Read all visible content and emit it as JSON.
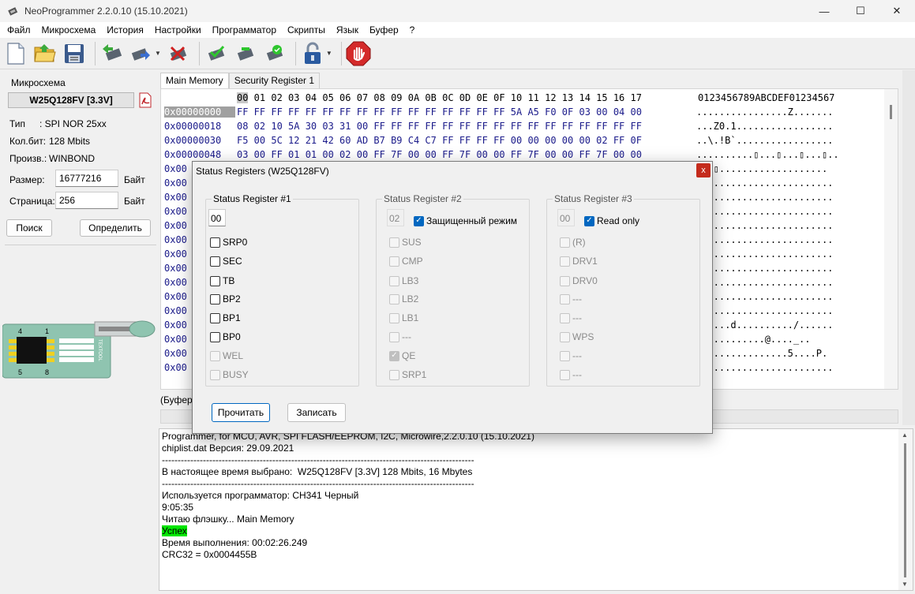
{
  "window": {
    "title": "NeoProgrammer 2.2.0.10 (15.10.2021)"
  },
  "menu": [
    "Файл",
    "Микросхема",
    "История",
    "Настройки",
    "Программатор",
    "Скрипты",
    "Язык",
    "Буфер",
    "?"
  ],
  "left": {
    "group_title": "Микросхема",
    "chip_name": "W25Q128FV [3.3V]",
    "type_label": "Тип",
    "type_value": ":  SPI NOR  25xx",
    "bits_label": "Кол.бит:",
    "bits_value": "128 Mbits",
    "mfr_label": "Произв.:",
    "mfr_value": "WINBOND",
    "size_label": "Размер:",
    "size_value": "16777216",
    "size_unit": "Байт",
    "page_label": "Страница:",
    "page_value": "256",
    "page_unit": "Байт",
    "search_btn": "Поиск",
    "detect_btn": "Определить"
  },
  "chip_image": {
    "pin4": "4",
    "pin1": "1",
    "pin5": "5",
    "pin8": "8",
    "brand": "TEXTOOL"
  },
  "tabs": [
    "Main Memory",
    "Security Register 1"
  ],
  "hex": {
    "header_first": "00",
    "header_rest": " 01 02 03 04 05 06 07 08 09 0A 0B 0C 0D 0E 0F 10 11 12 13 14 15 16 17",
    "ascii_header": "0123456789ABCDEF01234567",
    "rows": [
      {
        "addr": "0x00000000",
        "bytes": "FF FF FF FF FF FF FF FF FF FF FF FF FF FF FF FF 5A A5 F0 0F 03 00 04 00",
        "ascii": "................Z......."
      },
      {
        "addr": "0x00000018",
        "bytes": "08 02 10 5A 30 03 31 00 FF FF FF FF FF FF FF FF FF FF FF FF FF FF FF FF",
        "ascii": "...Z0.1................."
      },
      {
        "addr": "0x00000030",
        "bytes": "F5 00 5C 12 21 42 60 AD B7 B9 C4 C7 FF FF FF FF 00 00 00 00 00 02 FF 0F",
        "ascii": "..\\.!B`................."
      },
      {
        "addr": "0x00000048",
        "bytes": "03 00 FF 01 01 00 02 00 FF 7F 00 00 FF 7F 00 00 FF 7F 00 00 FF 7F 00 00",
        "ascii": "..........▯...▯...▯...▯.."
      },
      {
        "addr": "0x00",
        "bytes": "",
        "ascii": "...▯..................."
      },
      {
        "addr": "0x00",
        "bytes": "",
        "ascii": "........................"
      },
      {
        "addr": "0x00",
        "bytes": "",
        "ascii": "........................"
      },
      {
        "addr": "0x00",
        "bytes": "",
        "ascii": "........................"
      },
      {
        "addr": "0x00",
        "bytes": "",
        "ascii": "........................"
      },
      {
        "addr": "0x00",
        "bytes": "",
        "ascii": "........................"
      },
      {
        "addr": "0x00",
        "bytes": "",
        "ascii": "........................"
      },
      {
        "addr": "0x00",
        "bytes": "",
        "ascii": "........................"
      },
      {
        "addr": "0x00",
        "bytes": "",
        "ascii": "........................"
      },
      {
        "addr": "0x00",
        "bytes": "",
        "ascii": "........................"
      },
      {
        "addr": "0x00",
        "bytes": "",
        "ascii": "........................"
      },
      {
        "addr": "0x00",
        "bytes": "",
        "ascii": "......d........../......"
      },
      {
        "addr": "0x00",
        "bytes": "",
        "ascii": "............@...._.."
      },
      {
        "addr": "0x00",
        "bytes": "",
        "ascii": "P...............5....P."
      },
      {
        "addr": "0x00",
        "bytes": "",
        "ascii": "........................"
      }
    ]
  },
  "buffer_label": "(Буфер",
  "log": [
    "Programmer, for MCU, AVR, SPI FLASH/EEPROM, I2C, Microwire,2.2.0.10 (15.10.2021)",
    "chiplist.dat Версия: 29.09.2021",
    "---------------------------------------------------------------------------------------------------",
    "В настоящее время выбрано:  W25Q128FV [3.3V] 128 Mbits, 16 Mbytes",
    "---------------------------------------------------------------------------------------------------",
    "Используется программатор: CH341 Черный",
    "9:05:35",
    "Читаю флэшку... Main Memory",
    "Успех",
    "Время выполнения: 00:02:26.249",
    "CRC32 = 0x0004455B"
  ],
  "dialog": {
    "title": "Status Registers (W25Q128FV)",
    "close": "x",
    "sr1": {
      "legend": "Status Register #1",
      "value": "00",
      "bits": [
        "SRP0",
        "SEC",
        "TB",
        "BP2",
        "BP1",
        "BP0",
        "WEL",
        "BUSY"
      ]
    },
    "sr2": {
      "legend": "Status Register #2",
      "value": "02",
      "protected_label": "Защищенный режим",
      "bits": [
        "SUS",
        "CMP",
        "LB3",
        "LB2",
        "LB1",
        "---",
        "QE",
        "SRP1"
      ]
    },
    "sr3": {
      "legend": "Status Register #3",
      "value": "00",
      "readonly_label": "Read only",
      "bits": [
        "(R)",
        "DRV1",
        "DRV0",
        "---",
        "---",
        "WPS",
        "---",
        "---"
      ]
    },
    "read_btn": "Прочитать",
    "write_btn": "Записать"
  }
}
